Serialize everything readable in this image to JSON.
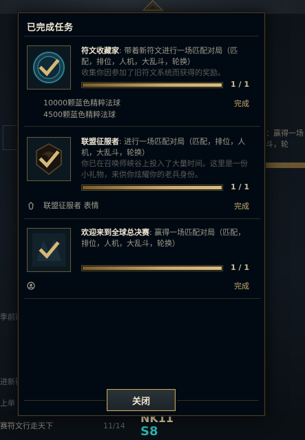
{
  "dialog": {
    "title": "已完成任务",
    "close_label": "关闭"
  },
  "missions": [
    {
      "name": "符文收藏家",
      "objective": ": 带着新符文进行一场匹配对局（匹配，排位，人机，大乱斗，轮换）",
      "description": "收集你因参加了旧符文系统而获得的奖励。",
      "progress_text": "1 / 1",
      "progress": 1.0,
      "rewards": [
        "10000颗蓝色精粹法球",
        "4500颗蓝色精粹法球"
      ],
      "status": "完成",
      "icon": "check-icon"
    },
    {
      "name": "联盟征服者",
      "objective": ": 进行一场匹配对局（匹配，排位，人机，大乱斗，轮换）",
      "description": "你已在召唤师峡谷上投入了大量时间。这里是一份小礼物，来供你炫耀你的老兵身份。",
      "progress_text": "1 / 1",
      "progress": 1.0,
      "rewards": [
        "联盟征服者 表情"
      ],
      "status": "完成",
      "icon": "check-icon",
      "reward_icon": "emote-icon"
    },
    {
      "name": "欢迎来到全球总决赛",
      "objective": ": 赢得一场匹配对局（匹配，排位，人机，大乱斗，轮换）",
      "description": "",
      "progress_text": "1 / 1",
      "progress": 1.0,
      "rewards": [],
      "status": "完成",
      "icon": "check-icon",
      "reward_icon": "icon-reward-icon"
    }
  ],
  "background": {
    "left_text_1": "季前赛",
    "left_text_2": "进新符",
    "left_text_3": "上单",
    "left_text_4": "赛符文行走天下",
    "left_text_5": "11/14",
    "right_text_1": "：赢得一场",
    "right_text_2": "斗，轮",
    "bottom_logo_1": "NK11",
    "bottom_logo_2": "S8"
  },
  "colors": {
    "gold": "#c8aa6e",
    "title": "#f0e6d2",
    "body": "#a09b8c",
    "muted": "#5b5a56",
    "panel": "#010a13"
  }
}
